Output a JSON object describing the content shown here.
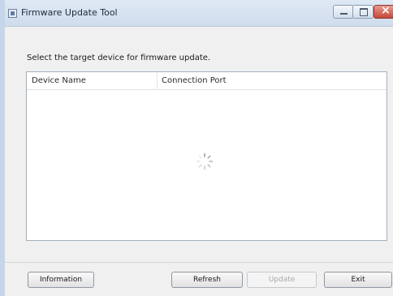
{
  "window": {
    "title": "Firmware Update Tool"
  },
  "main": {
    "instruction": "Select the target device for firmware update."
  },
  "device_list": {
    "columns": [
      "Device Name",
      "Connection Port"
    ],
    "rows": [],
    "loading": true
  },
  "buttons": {
    "information": "Information",
    "refresh": "Refresh",
    "update": "Update",
    "update_enabled": false,
    "exit": "Exit"
  },
  "colors": {
    "close_button": "#c7473a",
    "title_bar": "#dfe9f5",
    "disabled_text": "#a8a8a8"
  },
  "icons": {
    "app": "app-window-icon",
    "loading": "loading-spinner-icon"
  }
}
